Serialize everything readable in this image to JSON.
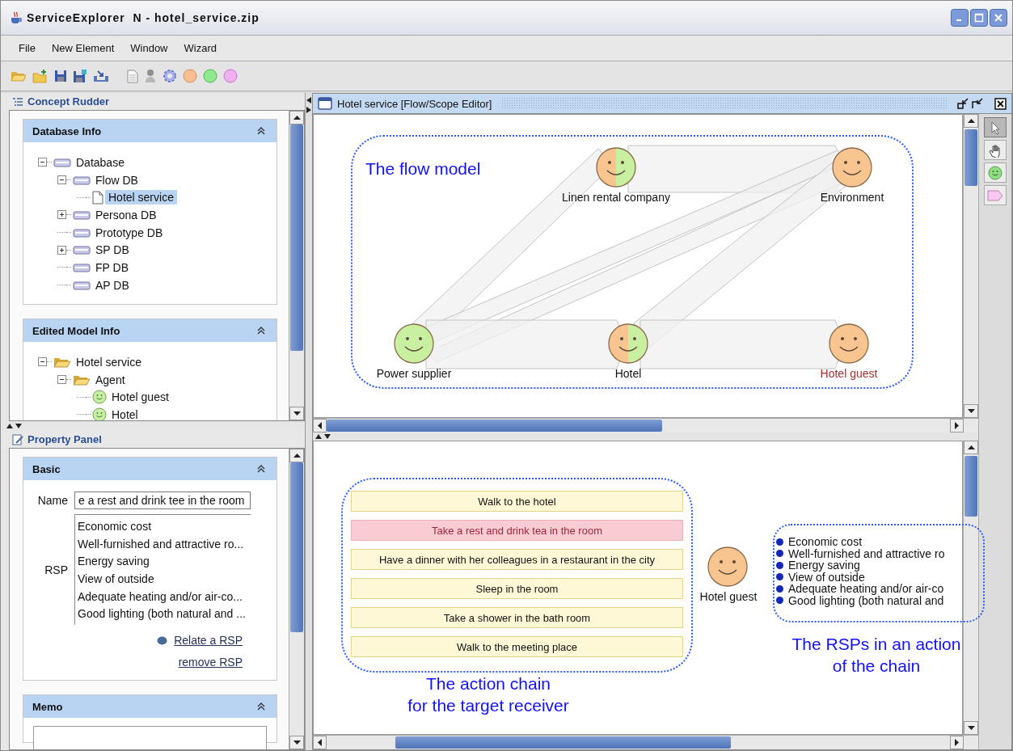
{
  "window": {
    "title": "ServiceExplorer  N - hotel_service.zip"
  },
  "menu": [
    "File",
    "New Element",
    "Window",
    "Wizard"
  ],
  "concept_rudder": {
    "title": "Concept Rudder",
    "sections": [
      {
        "title": "Database Info",
        "tree": [
          {
            "label": "Database",
            "kind": "database",
            "expanded": true,
            "selected": false,
            "children": [
              {
                "label": "Flow DB",
                "kind": "database",
                "expanded": true,
                "selected": false,
                "children": [
                  {
                    "label": "Hotel service",
                    "kind": "document",
                    "selected": true
                  }
                ]
              },
              {
                "label": "Persona DB",
                "kind": "database",
                "expanded": false,
                "selected": false
              },
              {
                "label": "Prototype DB",
                "kind": "database",
                "selected": false
              },
              {
                "label": "SP DB",
                "kind": "database",
                "expanded": false,
                "selected": false
              },
              {
                "label": "FP DB",
                "kind": "database",
                "selected": false
              },
              {
                "label": "AP DB",
                "kind": "database",
                "selected": false
              }
            ]
          }
        ]
      },
      {
        "title": "Edited Model Info",
        "tree": [
          {
            "label": "Hotel service",
            "kind": "folder",
            "expanded": true,
            "children": [
              {
                "label": "Agent",
                "kind": "folder",
                "expanded": true,
                "children": [
                  {
                    "label": "Hotel guest",
                    "kind": "agent"
                  },
                  {
                    "label": "Hotel",
                    "kind": "agent"
                  }
                ]
              }
            ]
          }
        ]
      }
    ]
  },
  "property_panel": {
    "title": "Property Panel",
    "basic": {
      "title": "Basic",
      "name_label": "Name",
      "name_value": "e a rest and drink tee in the room",
      "rsp_label": "RSP",
      "rsp_items": [
        "Economic cost",
        "Well-furnished and attractive ro...",
        "Energy saving",
        "View of outside",
        "Adequate heating and/or air-co...",
        "Good lighting (both natural and ..."
      ],
      "links": [
        "Relate a RSP",
        "remove RSP"
      ]
    },
    "memo": {
      "title": "Memo"
    }
  },
  "editor": {
    "title": "Hotel service [Flow/Scope Editor]",
    "palette": [
      {
        "kind": "pointer",
        "selected": true
      },
      {
        "kind": "hand",
        "selected": false
      },
      {
        "kind": "agent",
        "selected": false
      },
      {
        "kind": "tag",
        "selected": false
      }
    ],
    "flow_model": {
      "caption": "The flow model",
      "agents": [
        {
          "name": "Linen rental company",
          "kind": "both",
          "highlighted": false
        },
        {
          "name": "Environment",
          "kind": "receiver",
          "highlighted": false
        },
        {
          "name": "Power supplier",
          "kind": "provider",
          "highlighted": false
        },
        {
          "name": "Hotel",
          "kind": "both",
          "highlighted": false
        },
        {
          "name": "Hotel guest",
          "kind": "receiver",
          "highlighted": true
        }
      ]
    },
    "action_chain": {
      "caption": [
        "The action chain",
        "for the target receiver"
      ],
      "actions": [
        {
          "label": "Walk to the hotel",
          "selected": false
        },
        {
          "label": "Take a rest and drink tea in the room",
          "selected": true
        },
        {
          "label": "Have a dinner with her colleagues in a restaurant in the city",
          "selected": false
        },
        {
          "label": "Sleep in the room",
          "selected": false
        },
        {
          "label": "Take a shower in the bath room",
          "selected": false
        },
        {
          "label": "Walk to the meeting place",
          "selected": false
        }
      ],
      "receiver": "Hotel guest",
      "rsps": [
        "Economic cost",
        "Well-furnished and attractive ro",
        "Energy saving",
        "View of outside",
        "Adequate heating and/or air-co",
        "Good lighting (both natural and"
      ],
      "rsp_caption": [
        "The RSPs in an action",
        "of the chain"
      ]
    }
  }
}
